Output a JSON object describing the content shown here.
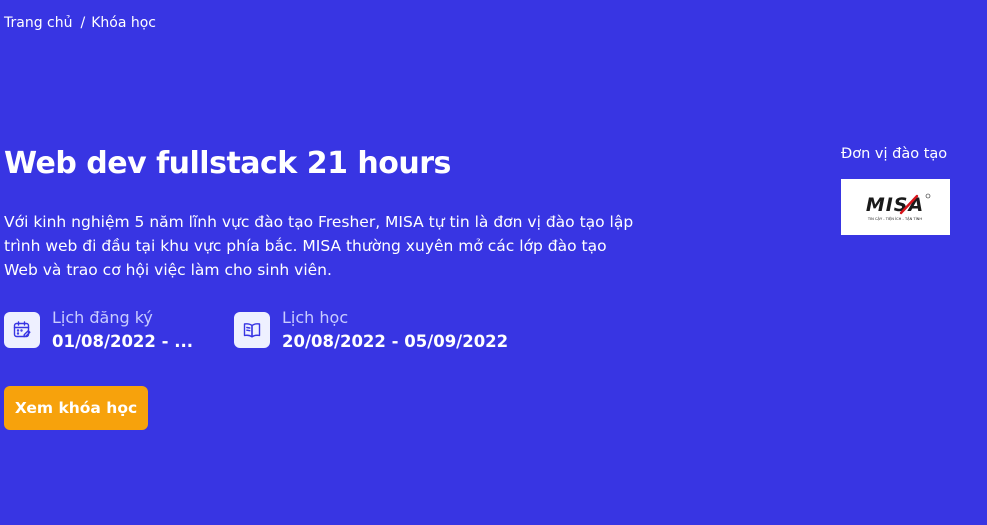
{
  "breadcrumb": {
    "home": "Trang chủ",
    "separator": "/",
    "current": "Khóa học"
  },
  "course": {
    "title": "Web dev fullstack 21 hours",
    "description": "Với kinh nghiệm 5 năm lĩnh vực đào tạo Fresher, MISA tự tin là đơn vị đào tạo lập trình web đi đầu tại khu vực phía bắc. MISA thường xuyên mở các lớp đào tạo Web và trao cơ hội việc làm cho sinh viên."
  },
  "schedule": {
    "registration": {
      "label": "Lịch đăng ký",
      "value": "01/08/2022 - ...",
      "icon": "calendar-edit-icon"
    },
    "study": {
      "label": "Lịch học",
      "value": "20/08/2022 - 05/09/2022",
      "icon": "book-open-icon"
    }
  },
  "cta": {
    "label": "Xem khóa học"
  },
  "organization": {
    "label": "Đơn vị đào tạo",
    "logo_text": "MISA",
    "logo_tagline": "TIN CẬY - TIỆN ÍCH - TẬN TÌNH"
  },
  "colors": {
    "background": "#3835e3",
    "button": "#f7a20c",
    "icon_bg": "#eef0ff",
    "icon_stroke": "#3835e3",
    "label_muted": "#c9ccff",
    "logo_red": "#d7141a"
  }
}
